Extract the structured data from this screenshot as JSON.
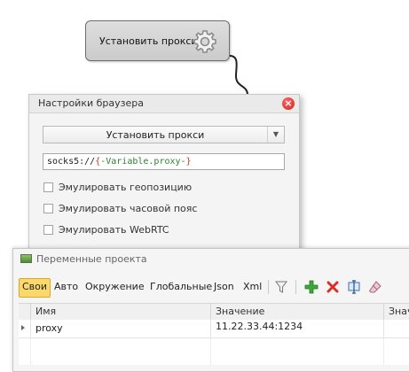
{
  "action_node": {
    "label": "Установить прокси",
    "icon": "gear-icon"
  },
  "browser_settings": {
    "title": "Настройки браузера",
    "close_icon": "close-icon",
    "action_select": "Установить прокси",
    "proxy_value": {
      "prefix": "socks5://",
      "open_brace": "{",
      "variable": "-Variable.proxy-",
      "close_brace": "}"
    },
    "checkboxes": [
      {
        "label": "Эмулировать геопозицию",
        "checked": false
      },
      {
        "label": "Эмулировать часовой пояс",
        "checked": false
      },
      {
        "label": "Эмулировать WebRTC",
        "checked": false
      }
    ]
  },
  "project_variables": {
    "title": "Переменные проекта",
    "tabs": [
      "Свои",
      "Авто",
      "Окружение",
      "Глобальные",
      "Json",
      "Xml"
    ],
    "active_tab": "Свои",
    "toolbar_icons": [
      "filter-icon",
      "add-icon",
      "delete-icon",
      "edit-icon",
      "eraser-icon"
    ],
    "columns": [
      "Имя",
      "Значение",
      "Значе"
    ],
    "rows": [
      {
        "name": "proxy",
        "value": "11.22.33.44:1234"
      }
    ]
  },
  "colors": {
    "active_tab": "#fbd86b",
    "close_button": "#d21d1d",
    "brace": "#c0392b",
    "variable": "#2e7d32",
    "add_icon": "#3aa83a",
    "delete_icon": "#d93025"
  }
}
